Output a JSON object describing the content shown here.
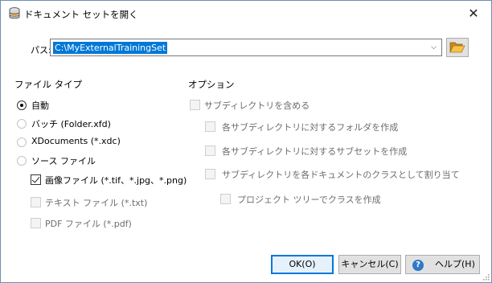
{
  "window": {
    "title": "ドキュメント セットを開く",
    "close_glyph": "✕"
  },
  "path": {
    "label": "パス:",
    "value": "C:\\MyExternalTrainingSet",
    "dropdown_glyph": "⌵"
  },
  "file_type": {
    "title": "ファイル タイプ",
    "options": [
      {
        "label": "自動",
        "selected": true
      },
      {
        "label": "バッチ (Folder.xfd)",
        "selected": false
      },
      {
        "label": "XDocuments (*.xdc)",
        "selected": false
      },
      {
        "label": "ソース ファイル",
        "selected": false
      }
    ],
    "source_types": [
      {
        "label": "画像ファイル (*.tif、*.jpg、*.png)",
        "checked": true
      },
      {
        "label": "テキスト ファイル (*.txt)",
        "checked": false
      },
      {
        "label": "PDF ファイル (*.pdf)",
        "checked": false
      }
    ]
  },
  "options": {
    "title": "オプション",
    "include_subdirs": "サブディレクトリを含める",
    "create_folder_per_subdir": "各サブディレクトリに対するフォルダを作成",
    "create_subset_per_subdir": "各サブディレクトリに対するサブセットを作成",
    "assign_subdir_as_class": "サブディレクトリを各ドキュメントのクラスとして割り当て",
    "create_class_in_project_tree": "プロジェクト ツリーでクラスを作成"
  },
  "buttons": {
    "ok": "OK(O)",
    "cancel": "キャンセル(C)",
    "help": "ヘルプ(H)",
    "help_glyph": "?"
  },
  "colors": {
    "accent": "#0078d7",
    "button_bg": "#e1e1e1",
    "disabled_text": "#6d6d6d"
  }
}
